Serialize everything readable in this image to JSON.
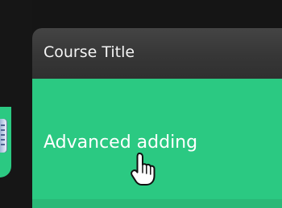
{
  "card": {
    "title": "Course Title",
    "item_label": "Advanced adding"
  },
  "icons": {
    "cursor": "hand-pointer-icon",
    "side": "document-icon"
  },
  "colors": {
    "background": "#151515",
    "header": "#363636",
    "accent_green": "#2bc982",
    "text": "#ffffff"
  }
}
